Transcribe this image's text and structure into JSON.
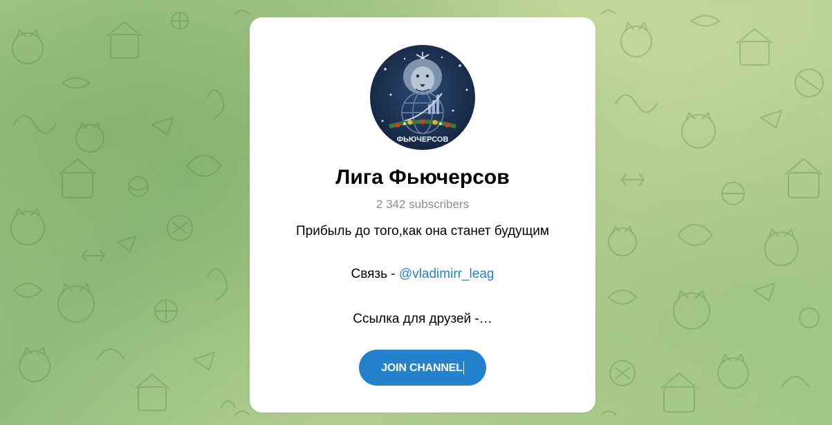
{
  "channel": {
    "name": "Лига Фьючерсов",
    "subscribers": "2 342 subscribers",
    "avatar_text": "ФЬЮЧЕРСОВ",
    "description": {
      "line1": "Прибыль до того,как она станет будущим",
      "line2_prefix": "Связь - ",
      "line2_link": "@vladimirr_leag",
      "line3": "Ссылка для друзей -…"
    }
  },
  "actions": {
    "join_label": "JOIN CHANNEL"
  },
  "colors": {
    "accent": "#2481cc",
    "card_bg": "#ffffff",
    "muted_text": "#8d8d8d",
    "background": "#a9c98b"
  }
}
